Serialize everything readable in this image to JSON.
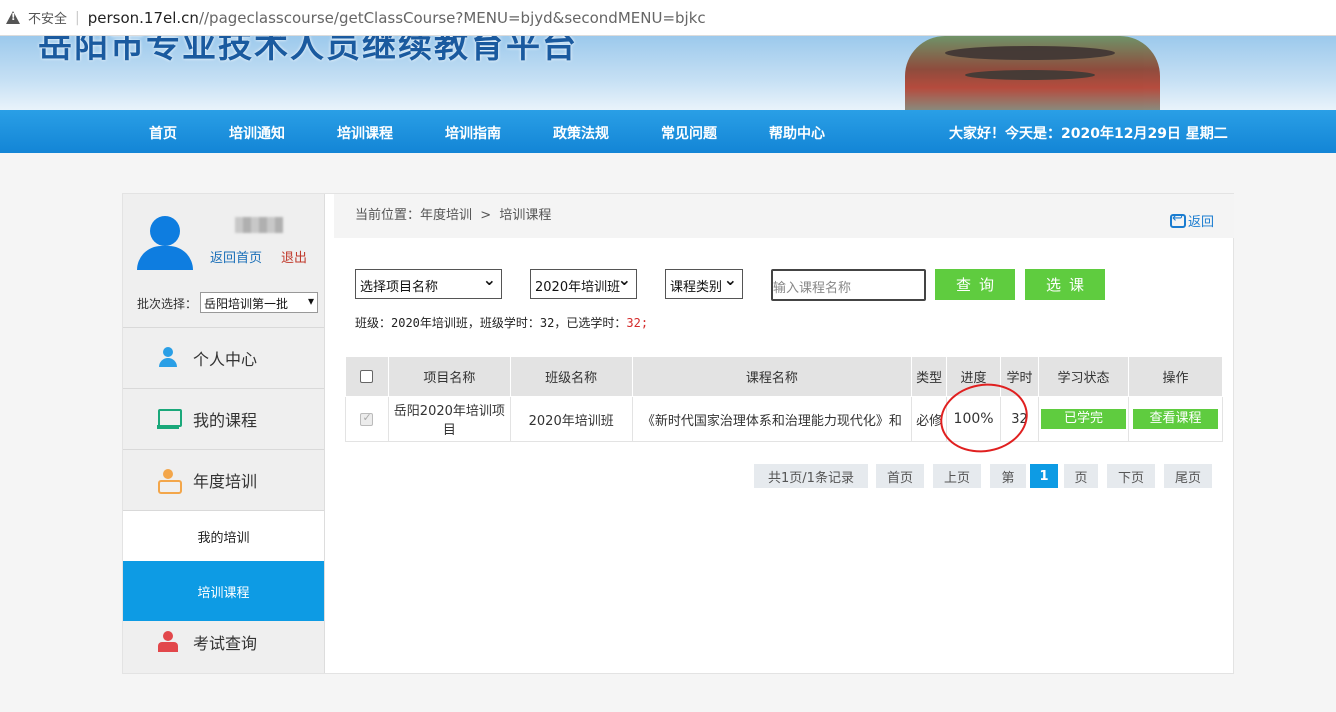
{
  "browser": {
    "insecure_label": "不安全",
    "url_host": "person.17el.cn",
    "url_path": "//pageclasscourse/getClassCourse?MENU=bjyd&secondMENU=bjkc"
  },
  "banner": {
    "title": "岳阳市专业技术人员继续教育平台"
  },
  "nav": {
    "items": [
      "首页",
      "培训通知",
      "培训课程",
      "培训指南",
      "政策法规",
      "常见问题",
      "帮助中心"
    ],
    "greeting": "大家好！今天是：2020年12月29日 星期二"
  },
  "sidebar": {
    "home_link": "返回首页",
    "logout": "退出",
    "batch_label": "批次选择：",
    "batch_value": "岳阳培训第一批",
    "menu": [
      "个人中心",
      "我的课程",
      "年度培训"
    ],
    "submenu": [
      "我的培训",
      "培训课程"
    ],
    "exam": "考试查询"
  },
  "main": {
    "breadcrumb": "当前位置：年度培训  >  培训课程",
    "back_label": "返回",
    "filters": {
      "project": "选择项目名称",
      "class": "2020年培训班",
      "category": "课程类别",
      "search_placeholder": "输入课程名称",
      "query_btn": "查询",
      "select_btn": "选课"
    },
    "class_info_prefix": "班级：2020年培训班，班级学时：32，已选学时：",
    "class_info_selected": "32",
    "class_info_suffix": ";",
    "table": {
      "headers": [
        "项目名称",
        "班级名称",
        "课程名称",
        "类型",
        "进度",
        "学时",
        "学习状态",
        "操作"
      ],
      "rows": [
        {
          "project": "岳阳2020年培训项目",
          "class": "2020年培训班",
          "course": "《新时代国家治理体系和治理能力现代化》和",
          "type": "必修",
          "progress": "100%",
          "hours": "32",
          "status": "已学完",
          "action": "查看课程"
        }
      ]
    },
    "pager": {
      "summary": "共1页/1条记录",
      "first": "首页",
      "prev": "上页",
      "goto_prefix": "第",
      "current": "1",
      "goto_suffix": "页",
      "next": "下页",
      "last": "尾页"
    }
  }
}
